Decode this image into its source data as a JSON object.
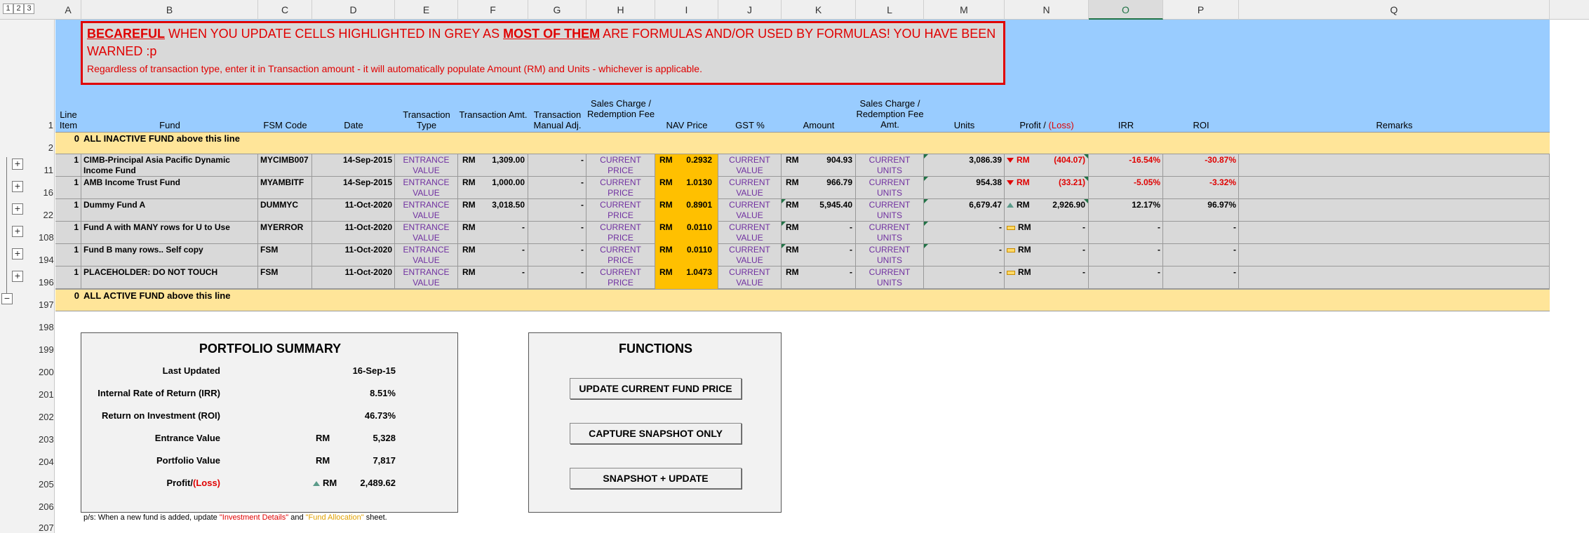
{
  "outline_levels": [
    "1",
    "2",
    "3"
  ],
  "columns": [
    {
      "letter": "A",
      "x": 0,
      "w": 0
    },
    {
      "letter": "B"
    },
    {
      "letter": "C"
    },
    {
      "letter": "D"
    },
    {
      "letter": "E"
    },
    {
      "letter": "F"
    },
    {
      "letter": "G"
    },
    {
      "letter": "H"
    },
    {
      "letter": "I"
    },
    {
      "letter": "J"
    },
    {
      "letter": "K"
    },
    {
      "letter": "L"
    },
    {
      "letter": "M"
    },
    {
      "letter": "N"
    },
    {
      "letter": "O"
    },
    {
      "letter": "P"
    },
    {
      "letter": "Q"
    }
  ],
  "rows": [
    "1",
    "2",
    "11",
    "16",
    "22",
    "108",
    "194",
    "196",
    "197",
    "198",
    "199",
    "200",
    "201",
    "202",
    "203",
    "204",
    "205",
    "206",
    "207"
  ],
  "warning": {
    "w1": "BECAREFUL",
    "w2": " WHEN YOU UPDATE CELLS HIGHLIGHTED IN GREY AS ",
    "w3": "MOST OF THEM",
    "w4": " ARE FORMULAS AND/OR USED BY FORMULAS! YOU HAVE BEEN WARNED :p",
    "line2": "Regardless of transaction type, enter it in Transaction amount - it will automatically populate Amount (RM) and Units - whichever is applicable."
  },
  "headers": {
    "line_item": "Line Item",
    "fund": "Fund",
    "fsm_code": "FSM Code",
    "date": "Date",
    "tx_type": "Transaction Type",
    "tx_amt": "Transaction Amt.",
    "tx_manual": "Transaction Manual Adj.",
    "sales_charge": "Sales Charge / Redemption Fee",
    "nav": "NAV Price",
    "gst": "GST %",
    "amount": "Amount",
    "fee_amt": "Sales Charge / Redemption Fee Amt.",
    "units": "Units",
    "profit_a": "Profit / ",
    "profit_b": "(Loss)",
    "irr": "IRR",
    "roi": "ROI",
    "remarks": "Remarks"
  },
  "inactive_band": {
    "count": "0",
    "label": "ALL INACTIVE FUND above this line"
  },
  "active_band": {
    "count": "0",
    "label": "ALL ACTIVE FUND above this line"
  },
  "funds": [
    {
      "line": "1",
      "name": "CIMB-Principal Asia Pacific Dynamic Income Fund",
      "code": "MYCIMB007",
      "date": "14-Sep-2015",
      "type_a": "ENTRANCE",
      "type_b": "VALUE",
      "cur": "RM",
      "tx_amt": "1,309.00",
      "manual": "-",
      "sc_a": "CURRENT",
      "sc_b": "PRICE",
      "nav": "0.2932",
      "gst_a": "CURRENT",
      "gst_b": "VALUE",
      "amount": "904.93",
      "fee_a": "CURRENT",
      "fee_b": "UNITS",
      "units": "3,086.39",
      "trend": "down",
      "profit": "(404.07)",
      "irr": "-16.54%",
      "roi": "-30.87%"
    },
    {
      "line": "1",
      "name": "AMB Income Trust Fund",
      "code": "MYAMBITF",
      "date": "14-Sep-2015",
      "type_a": "ENTRANCE",
      "type_b": "VALUE",
      "cur": "RM",
      "tx_amt": "1,000.00",
      "manual": "-",
      "sc_a": "CURRENT",
      "sc_b": "PRICE",
      "nav": "1.0130",
      "gst_a": "CURRENT",
      "gst_b": "VALUE",
      "amount": "966.79",
      "fee_a": "CURRENT",
      "fee_b": "UNITS",
      "units": "954.38",
      "trend": "down",
      "profit": "(33.21)",
      "irr": "-5.05%",
      "roi": "-3.32%"
    },
    {
      "line": "1",
      "name": "Dummy Fund A",
      "code": "DUMMYC",
      "date": "11-Oct-2020",
      "type_a": "ENTRANCE",
      "type_b": "VALUE",
      "cur": "RM",
      "tx_amt": "3,018.50",
      "manual": "-",
      "sc_a": "CURRENT",
      "sc_b": "PRICE",
      "nav": "0.8901",
      "gst_a": "CURRENT",
      "gst_b": "VALUE",
      "amount": "5,945.40",
      "fee_a": "CURRENT",
      "fee_b": "UNITS",
      "units": "6,679.47",
      "trend": "up",
      "profit": "2,926.90",
      "irr": "12.17%",
      "roi": "96.97%"
    },
    {
      "line": "1",
      "name": "Fund A with MANY rows for U to Use",
      "code": "MYERROR",
      "date": "11-Oct-2020",
      "type_a": "ENTRANCE",
      "type_b": "VALUE",
      "cur": "RM",
      "tx_amt": "-",
      "manual": "-",
      "sc_a": "CURRENT",
      "sc_b": "PRICE",
      "nav": "0.0110",
      "gst_a": "CURRENT",
      "gst_b": "VALUE",
      "amount": "-",
      "fee_a": "CURRENT",
      "fee_b": "UNITS",
      "units": "-",
      "trend": "flat",
      "profit": "-",
      "irr": "-",
      "roi": "-"
    },
    {
      "line": "1",
      "name": "Fund B many rows.. Self copy",
      "code": "FSM",
      "date": "11-Oct-2020",
      "type_a": "ENTRANCE",
      "type_b": "VALUE",
      "cur": "RM",
      "tx_amt": "-",
      "manual": "-",
      "sc_a": "CURRENT",
      "sc_b": "PRICE",
      "nav": "0.0110",
      "gst_a": "CURRENT",
      "gst_b": "VALUE",
      "amount": "-",
      "fee_a": "CURRENT",
      "fee_b": "UNITS",
      "units": "-",
      "trend": "flat",
      "profit": "-",
      "irr": "-",
      "roi": "-"
    },
    {
      "line": "1",
      "name": "PLACEHOLDER: DO NOT TOUCH",
      "code": "FSM",
      "date": "11-Oct-2020",
      "type_a": "ENTRANCE",
      "type_b": "VALUE",
      "cur": "RM",
      "tx_amt": "-",
      "manual": "-",
      "sc_a": "CURRENT",
      "sc_b": "PRICE",
      "nav": "1.0473",
      "gst_a": "CURRENT",
      "gst_b": "VALUE",
      "amount": "-",
      "fee_a": "CURRENT",
      "fee_b": "UNITS",
      "units": "-",
      "trend": "flat",
      "profit": "-",
      "irr": "-",
      "roi": "-"
    }
  ],
  "summary": {
    "title": "PORTFOLIO SUMMARY",
    "last_updated_label": "Last Updated",
    "last_updated": "16-Sep-15",
    "irr_label": "Internal Rate of Return (IRR)",
    "irr": "8.51%",
    "roi_label": "Return on Investment (ROI)",
    "roi": "46.73%",
    "entrance_label": "Entrance Value",
    "entrance": "5,328",
    "portfolio_label": "Portfolio Value",
    "portfolio": "7,817",
    "profit_label_a": "Profit/",
    "profit_label_b": "(Loss)",
    "profit": "2,489.62",
    "currency": "RM"
  },
  "functions": {
    "title": "FUNCTIONS",
    "btn_update": "UPDATE CURRENT FUND PRICE",
    "btn_capture": "CAPTURE SNAPSHOT ONLY",
    "btn_both": "SNAPSHOT + UPDATE"
  },
  "note": {
    "a": "p/s: When a new fund is added, update ",
    "b": "\"Investment Details\"",
    "c": " and ",
    "d": "\"Fund Allocation\"",
    "e": " sheet."
  },
  "colors": {
    "accent_red": "#e00000",
    "nav_fill": "#ffc000",
    "header_blue": "#99ccff",
    "band_yellow": "#ffe599"
  }
}
